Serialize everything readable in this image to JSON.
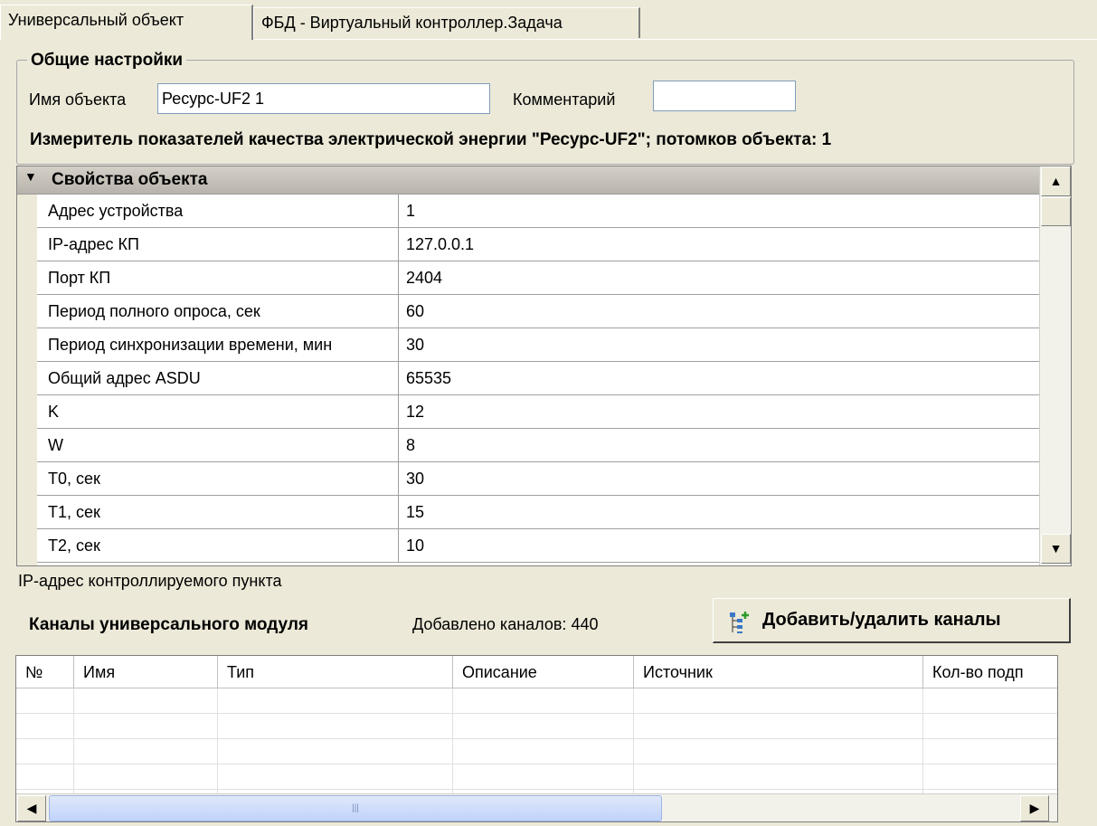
{
  "tabs": [
    {
      "label": "Универсальный объект",
      "active": true
    },
    {
      "label": "ФБД - Виртуальный контроллер.Задача",
      "active": false
    }
  ],
  "general": {
    "legend": "Общие настройки",
    "name_label": "Имя объекта",
    "name_value": "Ресурс-UF2 1",
    "comment_label": "Комментарий",
    "comment_value": "",
    "description": "Измеритель показателей качества электрической энергии \"Ресурс-UF2\"; потомков объекта: 1"
  },
  "properties": {
    "header": "Свойства объекта",
    "rows": [
      {
        "name": "Адрес устройства",
        "value": "1"
      },
      {
        "name": "IP-адрес КП",
        "value": "127.0.0.1"
      },
      {
        "name": "Порт КП",
        "value": "2404"
      },
      {
        "name": "Период полного опроса, сек",
        "value": "60"
      },
      {
        "name": "Период синхронизации времени, мин",
        "value": "30"
      },
      {
        "name": "Общий адрес ASDU",
        "value": "65535"
      },
      {
        "name": "K",
        "value": "12"
      },
      {
        "name": "W",
        "value": "8"
      },
      {
        "name": "T0, сек",
        "value": "30"
      },
      {
        "name": "T1, сек",
        "value": "15"
      },
      {
        "name": "T2, сек",
        "value": "10"
      }
    ],
    "hint": "IP-адрес контроллируемого пункта"
  },
  "channels": {
    "title": "Каналы универсального модуля",
    "count_text": "Добавлено каналов: 440",
    "add_button": "Добавить/удалить каналы",
    "columns": [
      "№",
      "Имя",
      "Тип",
      "Описание",
      "Источник",
      "Кол-во подп"
    ]
  },
  "icons": {
    "collapse": "triangle-down-icon",
    "scroll_up": "arrow-up-icon",
    "scroll_down": "arrow-down-icon",
    "scroll_left": "arrow-left-icon",
    "scroll_right": "arrow-right-icon",
    "add": "tree-add-icon"
  }
}
